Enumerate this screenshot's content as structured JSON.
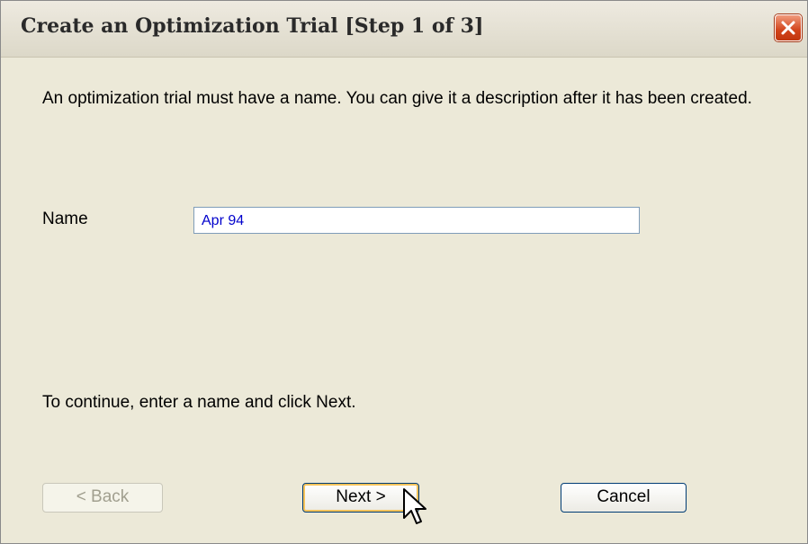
{
  "dialog": {
    "title": "Create an Optimization Trial [Step 1 of 3]",
    "intro": "An optimization trial must have a name. You can give it a description after it has been created.",
    "name_label": "Name",
    "name_value": "Apr 94",
    "continue_text": "To continue, enter a name and click Next.",
    "buttons": {
      "back": "< Back",
      "next": "Next >",
      "cancel": "Cancel"
    }
  },
  "icons": {
    "close": "close-icon",
    "cursor": "mouse-pointer-icon"
  },
  "colors": {
    "background": "#ece9d8",
    "input_text": "#0000cc",
    "close_button": "#d2431a",
    "focus_highlight": "#f6c35a"
  }
}
